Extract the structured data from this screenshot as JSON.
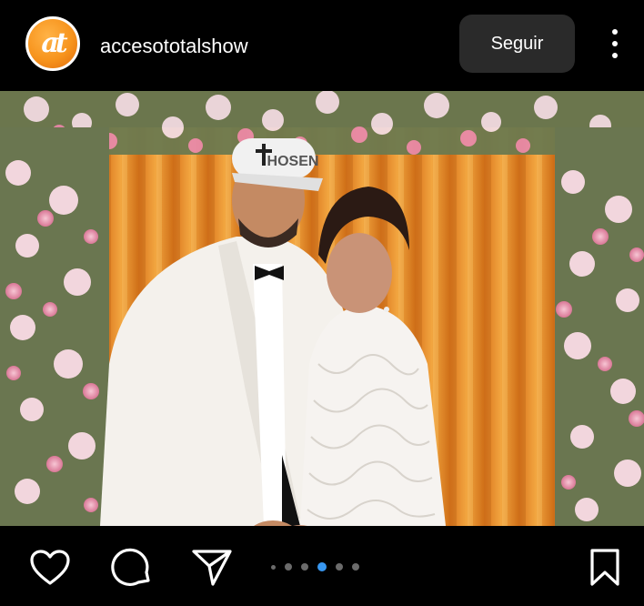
{
  "header": {
    "avatar_mark": "at",
    "username": "accesototalshow",
    "follow_label": "Seguir",
    "more_icon": "more-vertical-icon"
  },
  "post": {
    "cap_text": "HOSEN",
    "carousel": {
      "total": 6,
      "current": 4
    }
  },
  "actions": {
    "like_icon": "heart-icon",
    "comment_icon": "comment-icon",
    "share_icon": "send-icon",
    "save_icon": "bookmark-icon"
  },
  "colors": {
    "background": "#000000",
    "follow_button": "#2a2a2a",
    "active_dot": "#3897f0",
    "inactive_dot": "#6b6b6b",
    "avatar_orange": "#f7941d"
  }
}
